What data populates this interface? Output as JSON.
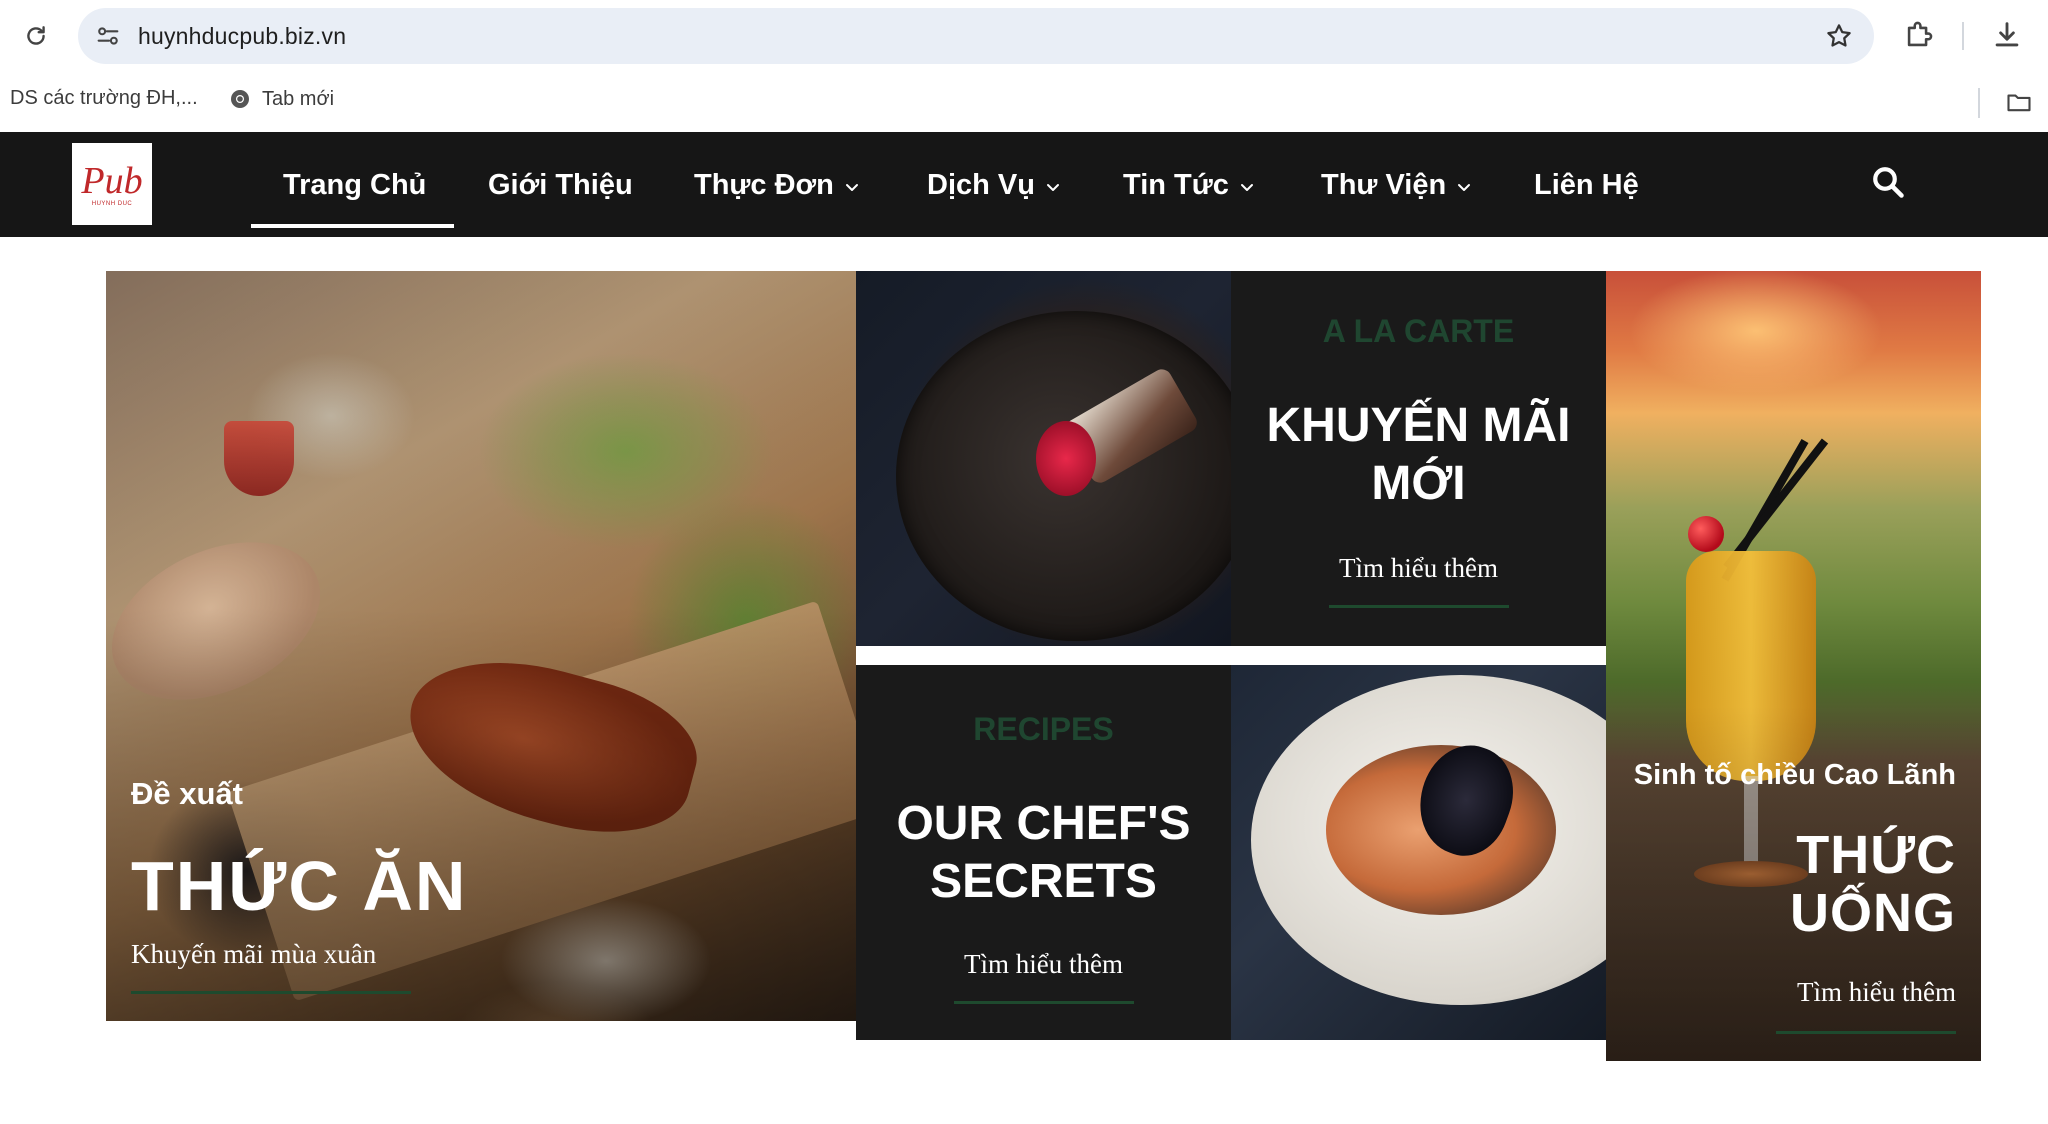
{
  "browser": {
    "url": "huynhducpub.biz.vn",
    "bookmarks": [
      {
        "label": "DS các trường ĐH,..."
      },
      {
        "label": "Tab mới"
      }
    ]
  },
  "site": {
    "logo_text": "Pub",
    "logo_subtext": "HUYNH DUC",
    "nav": [
      {
        "label": "Trang Chủ",
        "active": true
      },
      {
        "label": "Giới Thiệu"
      },
      {
        "label": "Thực Đơn",
        "has_dropdown": true
      },
      {
        "label": "Dịch Vụ",
        "has_dropdown": true
      },
      {
        "label": "Tin Tức",
        "has_dropdown": true
      },
      {
        "label": "Thư Viện",
        "has_dropdown": true
      },
      {
        "label": "Liên Hệ"
      }
    ]
  },
  "promos": {
    "food": {
      "kicker": "Đề xuất",
      "title": "THỨC ĂN",
      "link": "Khuyến mãi mùa xuân"
    },
    "carte": {
      "kicker": "A LA CARTE",
      "title_line1": "KHUYẾN MÃI",
      "title_line2": "MỚI",
      "link": "Tìm hiểu thêm"
    },
    "chef": {
      "kicker": "RECIPES",
      "title_line1": "OUR CHEF'S",
      "title_line2": "SECRETS",
      "link": "Tìm hiểu thêm"
    },
    "drink": {
      "kicker": "Sinh tố chiều Cao Lãnh",
      "title_line1": "THỨC",
      "title_line2": "UỐNG",
      "link": "Tìm hiểu thêm"
    }
  },
  "colors": {
    "nav_bg": "#161616",
    "panel_bg": "#1a1a1a",
    "accent_green": "#1e4a2e",
    "logo_red": "#c0282a",
    "omnibox_bg": "#e9eef6"
  },
  "icons": [
    "reload-icon",
    "site-info-icon",
    "bookmark-star-icon",
    "extensions-icon",
    "download-icon",
    "chrome-icon",
    "folder-icon",
    "search-icon",
    "chevron-down-icon"
  ]
}
